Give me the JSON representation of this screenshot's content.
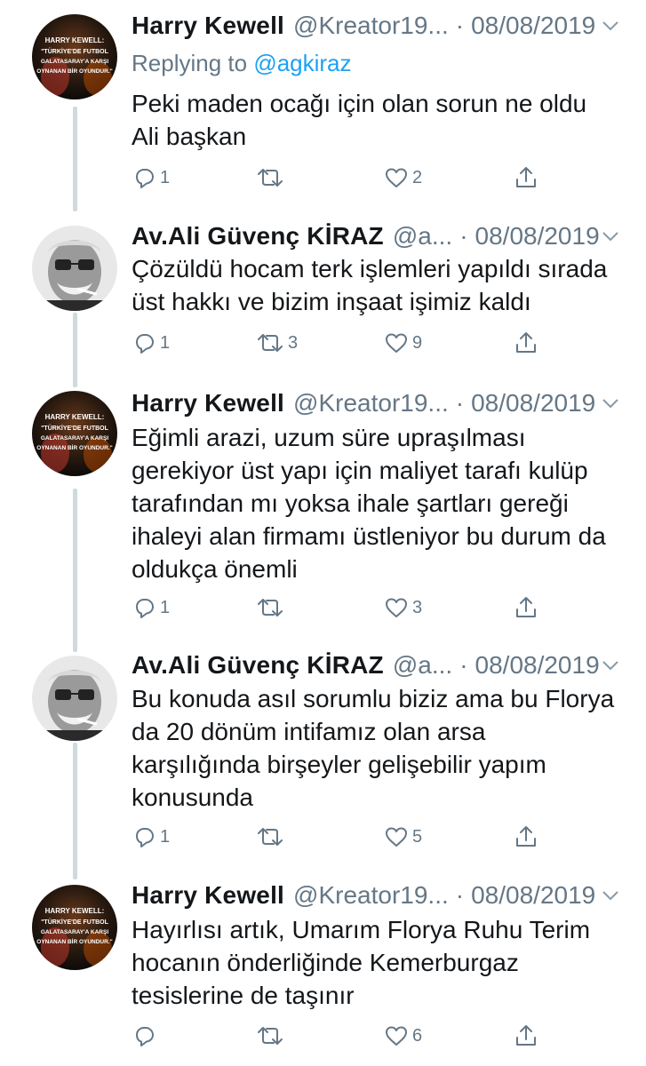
{
  "tweets": [
    {
      "author": "Harry Kewell",
      "handle": "@Kreator19...",
      "date": "08/08/2019",
      "replying_prefix": "Replying to",
      "replying_mention": "@agkiraz",
      "lines": [
        "Peki maden ocağı için olan sorun ne oldu",
        "Ali başkan"
      ],
      "reply_count": "1",
      "retweet_count": "",
      "like_count": "2",
      "avatar_text": [
        "HARRY KEWELL:",
        "\"TÜRKİYE'DE FUTBOL",
        "GALATASARAY'A KARŞI",
        "OYNANAN BİR OYUNDUR.\""
      ]
    },
    {
      "author": "Av.Ali Güvenç KİRAZ",
      "handle": "@a...",
      "date": "08/08/2019",
      "lines": [
        "Çözüldü hocam terk işlemleri yapıldı sırada",
        "üst hakkı ve bizim inşaat işimiz kaldı"
      ],
      "reply_count": "1",
      "retweet_count": "3",
      "like_count": "9"
    },
    {
      "author": "Harry Kewell",
      "handle": "@Kreator19...",
      "date": "08/08/2019",
      "lines": [
        "Eğimli arazi, uzum süre upraşılması",
        "gerekiyor üst yapı için maliyet tarafı kulüp",
        "tarafından mı yoksa ihale şartları gereği",
        "ihaleyi alan firmamı üstleniyor bu durum da",
        "oldukça önemli"
      ],
      "reply_count": "1",
      "retweet_count": "",
      "like_count": "3",
      "avatar_text": [
        "HARRY KEWELL:",
        "\"TÜRKİYE'DE FUTBOL",
        "GALATASARAY'A KARŞI",
        "OYNANAN BİR OYUNDUR.\""
      ]
    },
    {
      "author": "Av.Ali Güvenç KİRAZ",
      "handle": "@a...",
      "date": "08/08/2019",
      "lines": [
        "Bu konuda asıl sorumlu biziz ama bu Florya",
        "da 20 dönüm intifamız olan arsa",
        "karşılığında birşeyler gelişebilir yapım",
        "konusunda"
      ],
      "reply_count": "1",
      "retweet_count": "",
      "like_count": "5"
    },
    {
      "author": "Harry Kewell",
      "handle": "@Kreator19...",
      "date": "08/08/2019",
      "lines": [
        "Hayırlısı artık, Umarım Florya Ruhu Terim",
        "hocanın önderliğinde Kemerburgaz",
        "tesislerine de taşınır"
      ],
      "reply_count": "",
      "retweet_count": "",
      "like_count": "6",
      "avatar_text": [
        "HARRY KEWELL:",
        "\"TÜRKİYE'DE FUTBOL",
        "GALATASARAY'A KARŞI",
        "OYNANAN BİR OYUNDUR.\""
      ]
    }
  ],
  "icons": {
    "reply": "reply-icon",
    "retweet": "retweet-icon",
    "like": "heart-icon",
    "share": "share-icon",
    "menu": "chevron-down-icon"
  },
  "colors": {
    "secondary_text": "#657786",
    "mention": "#1da1f2",
    "thread_line": "#cfd9de",
    "avatar_dark": "#1a1a1a"
  }
}
